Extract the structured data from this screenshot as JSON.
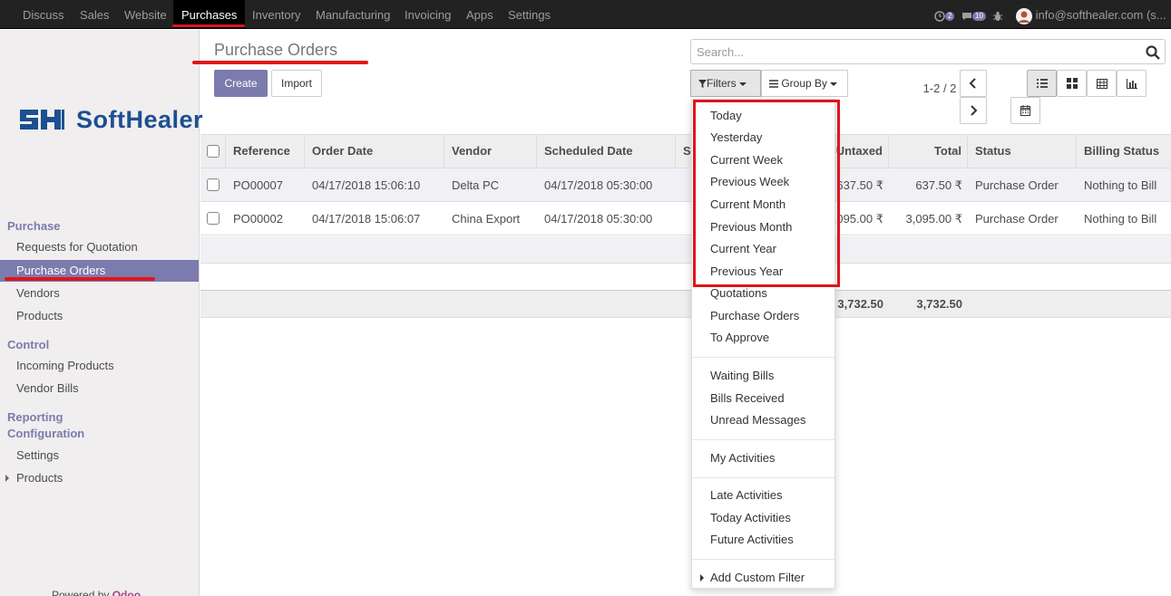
{
  "navbar": {
    "items": [
      "Discuss",
      "Sales",
      "Website",
      "Purchases",
      "Inventory",
      "Manufacturing",
      "Invoicing",
      "Apps",
      "Settings"
    ],
    "active": "Purchases",
    "activity_count": "2",
    "message_count": "10",
    "user": "info@softhealer.com (s..."
  },
  "sidebar": {
    "logo_text": "SoftHealer",
    "sections": [
      {
        "title": "Purchase",
        "items": [
          "Requests for Quotation",
          "Purchase Orders",
          "Vendors",
          "Products"
        ]
      },
      {
        "title": "Control",
        "items": [
          "Incoming Products",
          "Vendor Bills"
        ]
      },
      {
        "title": "Reporting",
        "items": []
      },
      {
        "title": "Configuration",
        "items": [
          "Settings",
          "Products"
        ]
      }
    ],
    "active_item": "Purchase Orders",
    "powered_by": "Powered by",
    "powered_brand": "Odoo"
  },
  "control_panel": {
    "title": "Purchase Orders",
    "create_label": "Create",
    "import_label": "Import",
    "search_placeholder": "Search...",
    "filters_label": "Filters",
    "group_by_label": "Group By",
    "pager_value": "1-2 / 2"
  },
  "table": {
    "columns": [
      "Reference",
      "Order Date",
      "Vendor",
      "Scheduled Date",
      "S",
      "Untaxed",
      "Total",
      "Status",
      "Billing Status"
    ],
    "rows": [
      {
        "reference": "PO00007",
        "order_date": "04/17/2018 15:06:10",
        "vendor": "Delta PC",
        "scheduled_date": "04/17/2018 05:30:00",
        "untaxed": "637.50 ₹",
        "total": "637.50 ₹",
        "status": "Purchase Order",
        "billing_status": "Nothing to Bill"
      },
      {
        "reference": "PO00002",
        "order_date": "04/17/2018 15:06:07",
        "vendor": "China Export",
        "scheduled_date": "04/17/2018 05:30:00",
        "untaxed": "3,095.00 ₹",
        "total": "3,095.00 ₹",
        "status": "Purchase Order",
        "billing_status": "Nothing to Bill"
      }
    ],
    "footer": {
      "untaxed": "3,732.50",
      "total": "3,732.50"
    }
  },
  "filters_menu": {
    "groups": [
      [
        "Today",
        "Yesterday",
        "Current Week",
        "Previous Week",
        "Current Month",
        "Previous Month",
        "Current Year",
        "Previous Year",
        "Quotations",
        "Purchase Orders",
        "To Approve"
      ],
      [
        "Waiting Bills",
        "Bills Received",
        "Unread Messages"
      ],
      [
        "My Activities"
      ],
      [
        "Late Activities",
        "Today Activities",
        "Future Activities"
      ]
    ],
    "custom_filter": "Add Custom Filter"
  },
  "annotation_color": "#e0141c",
  "accent_color": "#7c7bad"
}
